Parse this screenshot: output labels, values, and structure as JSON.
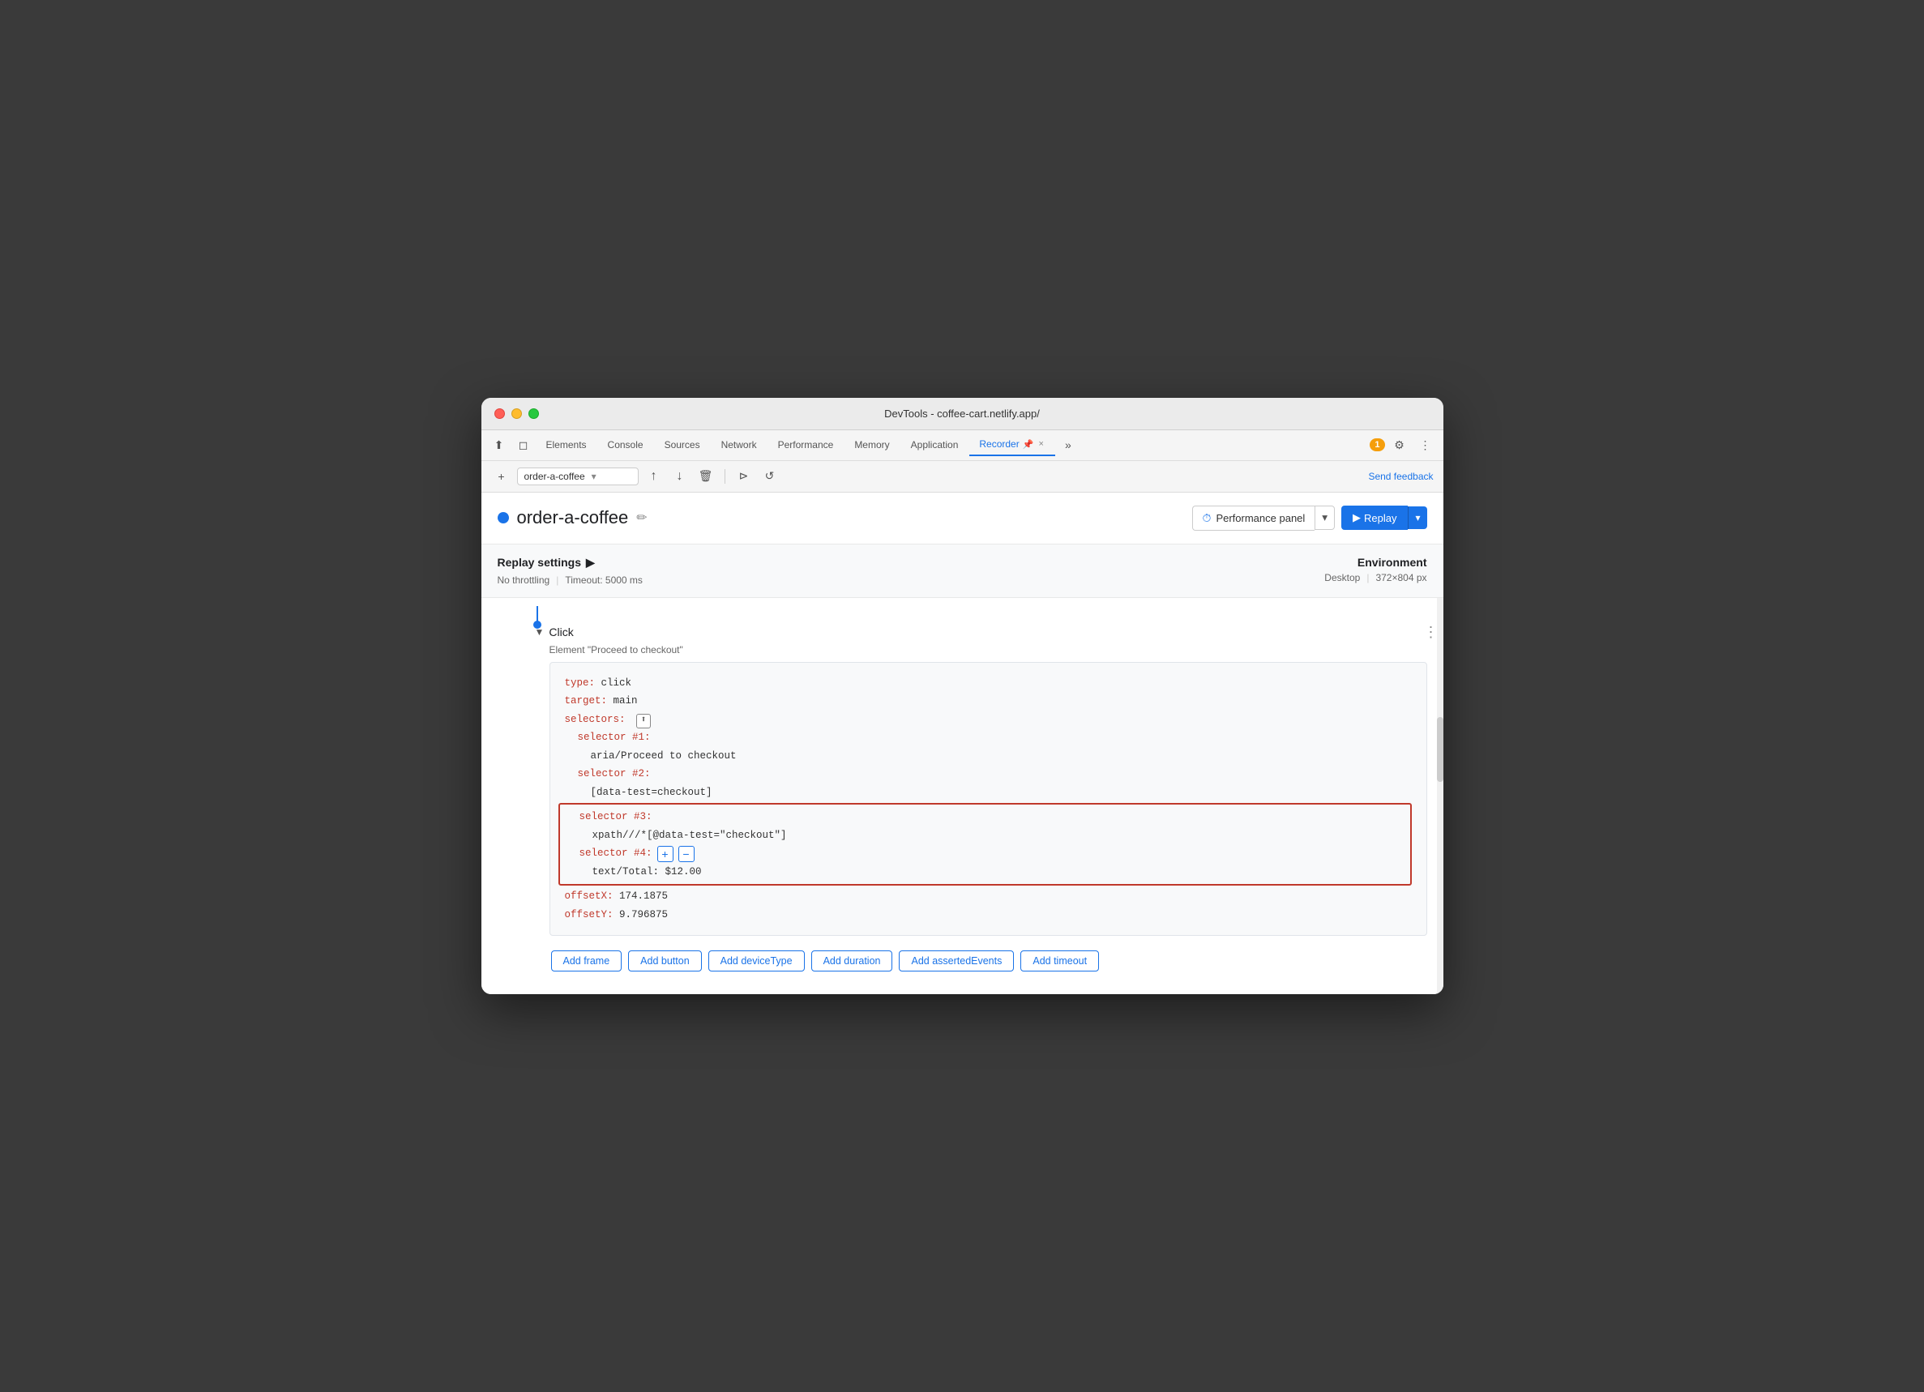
{
  "window": {
    "title": "DevTools - coffee-cart.netlify.app/"
  },
  "tabs": {
    "items": [
      {
        "label": "Elements",
        "active": false
      },
      {
        "label": "Console",
        "active": false
      },
      {
        "label": "Sources",
        "active": false
      },
      {
        "label": "Network",
        "active": false
      },
      {
        "label": "Performance",
        "active": false
      },
      {
        "label": "Memory",
        "active": false
      },
      {
        "label": "Application",
        "active": false
      },
      {
        "label": "Recorder",
        "active": true
      },
      {
        "label": "×",
        "active": false
      }
    ],
    "more_label": "»",
    "notification_count": "1"
  },
  "toolbar": {
    "new_label": "+",
    "recording_name": "order-a-coffee",
    "send_feedback": "Send feedback"
  },
  "recording": {
    "title": "order-a-coffee",
    "edit_icon": "✏"
  },
  "buttons": {
    "performance_panel": "Performance panel",
    "replay": "Replay"
  },
  "settings": {
    "title": "Replay settings",
    "throttling": "No throttling",
    "timeout": "Timeout: 5000 ms",
    "env_title": "Environment",
    "env_type": "Desktop",
    "env_size": "372×804 px"
  },
  "step": {
    "type": "Click",
    "description": "Element \"Proceed to checkout\"",
    "code": {
      "type_key": "type:",
      "type_val": " click",
      "target_key": "target:",
      "target_val": " main",
      "selectors_key": "selectors:",
      "selector1_key": "selector #1:",
      "selector1_val": "aria/Proceed to checkout",
      "selector2_key": "selector #2:",
      "selector2_val": "[data-test=checkout]",
      "selector3_key": "selector #3:",
      "selector3_val": "xpath///*[@data-test=\"checkout\"]",
      "selector4_key": "selector #4:",
      "selector4_val": "text/Total: $12.00",
      "offsetx_key": "offsetX:",
      "offsetx_val": " 174.1875",
      "offsety_key": "offsetY:",
      "offsety_val": " 9.796875"
    }
  },
  "action_buttons": {
    "add_frame": "Add frame",
    "add_button": "Add button",
    "add_device_type": "Add deviceType",
    "add_duration": "Add duration",
    "add_asserted_events": "Add assertedEvents",
    "add_timeout": "Add timeout"
  },
  "icons": {
    "expand_arrow": "▼",
    "collapse_arrow": "▶",
    "chevron_down": "▾",
    "play": "▶",
    "edit": "✏",
    "more_vert": "⋮",
    "cursor": "⬆",
    "export": "↑",
    "import": "↓",
    "delete": "🗑",
    "step_over": "⇥",
    "history": "↺",
    "selector_icon": "⬆"
  }
}
